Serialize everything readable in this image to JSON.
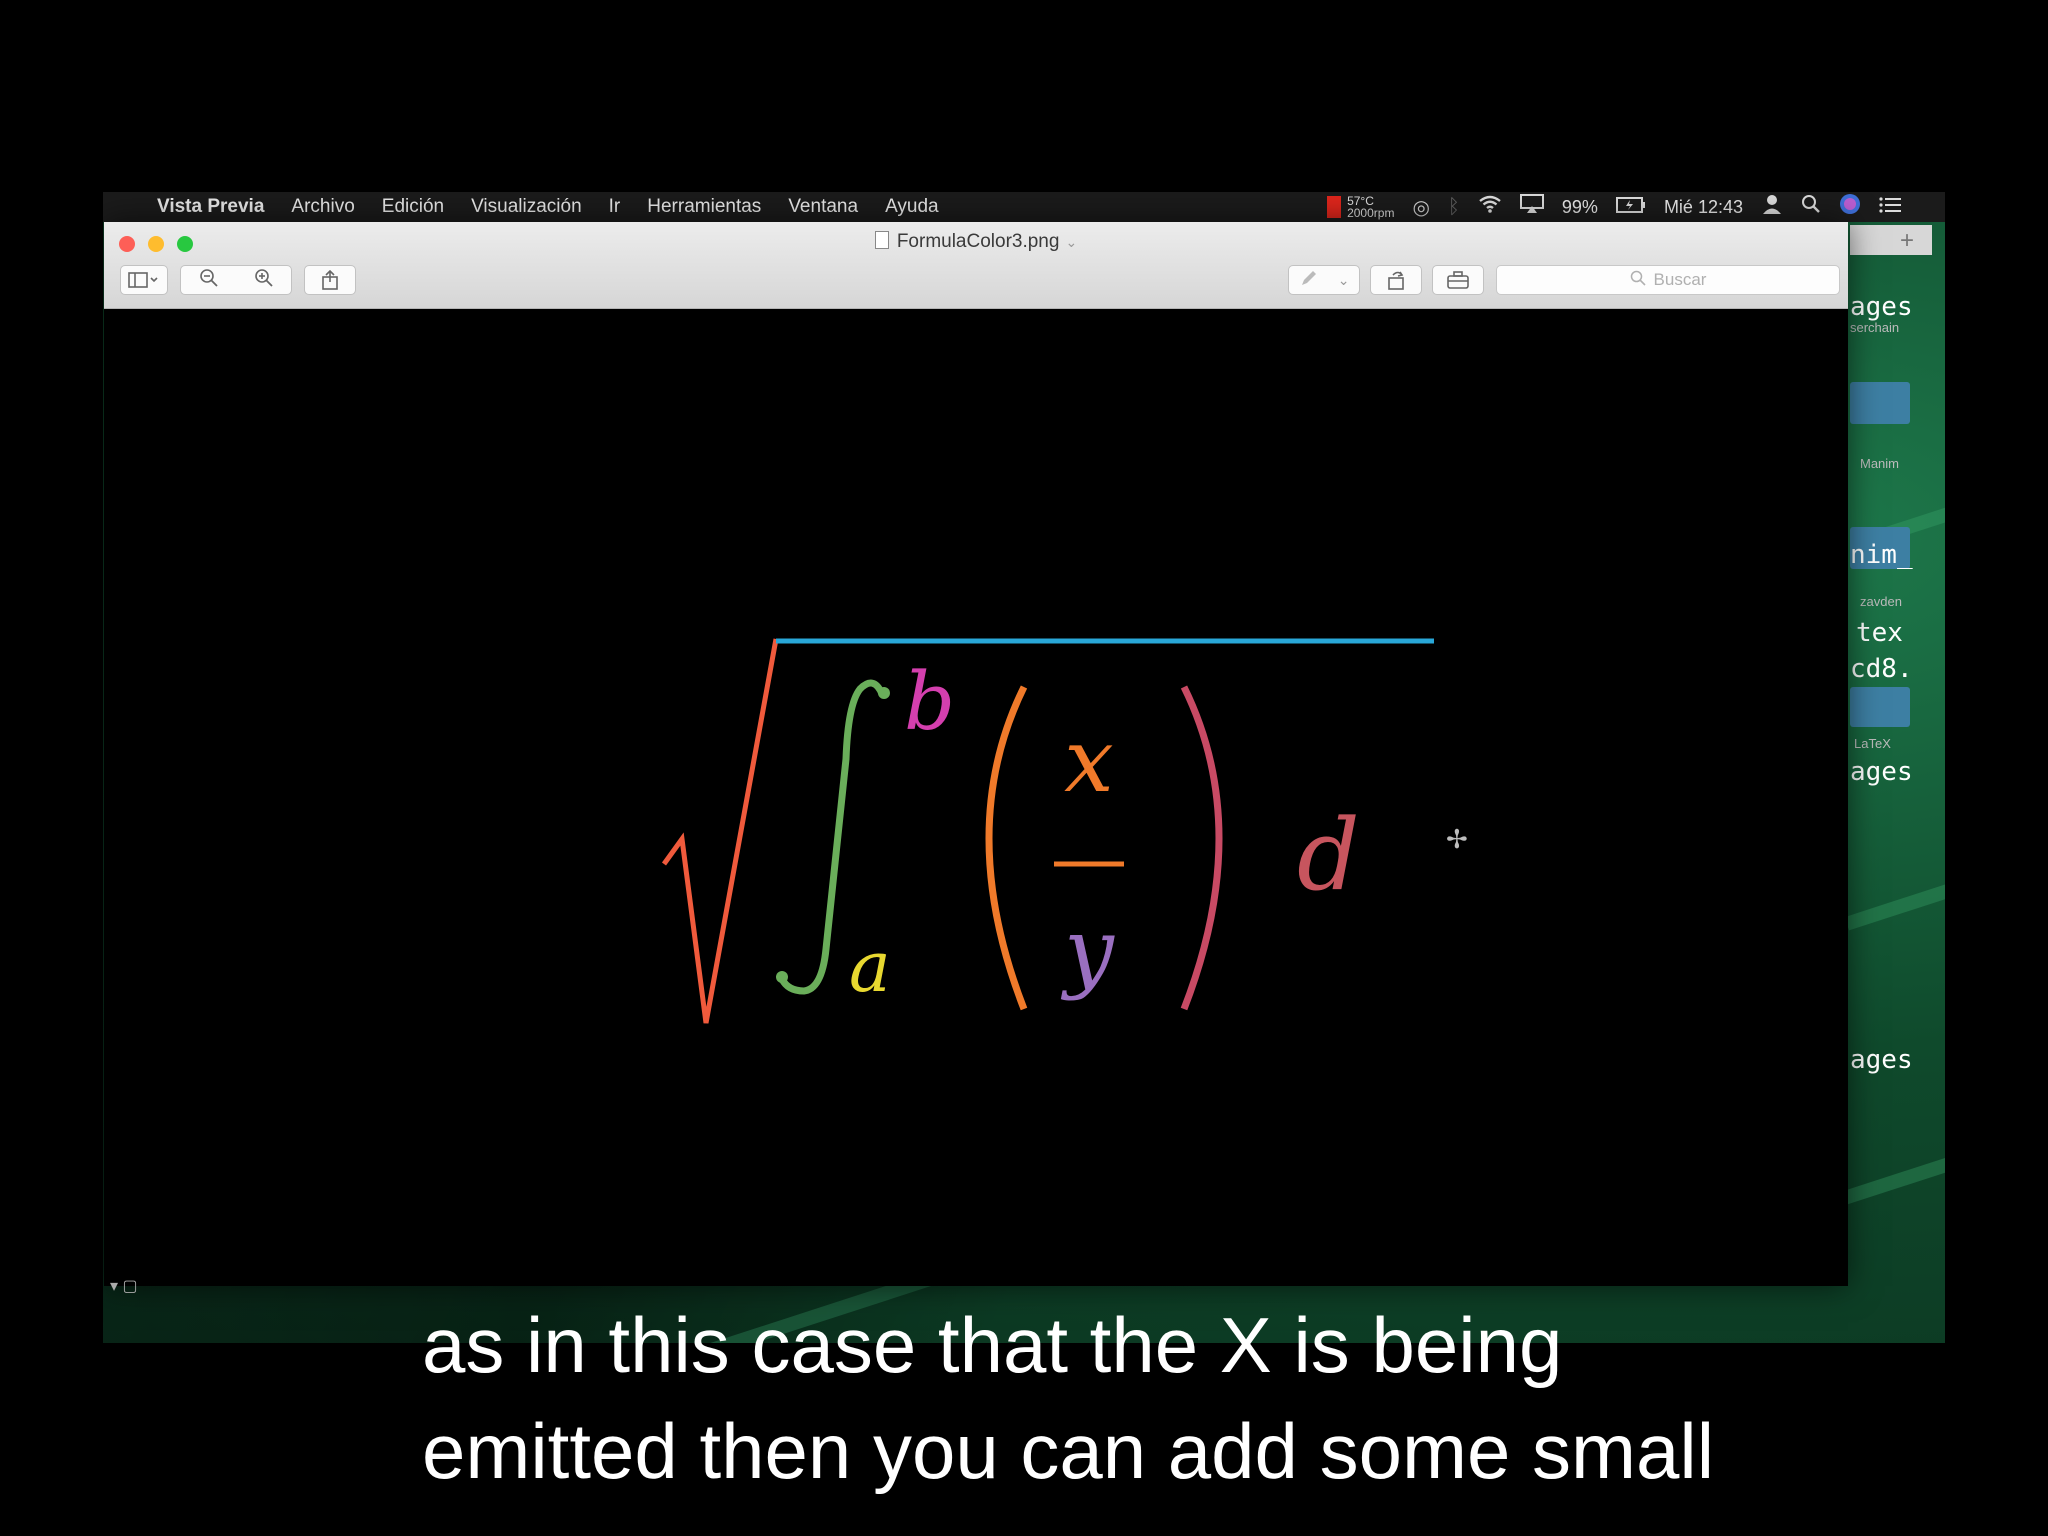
{
  "menubar": {
    "app_name": "Vista Previa",
    "items": [
      "Archivo",
      "Edición",
      "Visualización",
      "Ir",
      "Herramientas",
      "Ventana",
      "Ayuda"
    ],
    "status": {
      "temperature": "57°C",
      "fan": "2000rpm",
      "battery": "99%",
      "clock": "Mié 12:43"
    }
  },
  "window": {
    "title": "FormulaColor3.png",
    "search_placeholder": "Buscar"
  },
  "formula": {
    "upper_limit": "b",
    "lower_limit": "a",
    "numerator": "x",
    "denominator": "y",
    "trailing": "d",
    "colors": {
      "radical": "#f05a3c",
      "vinculum": "#29a7d8",
      "integral": "#6aae5a",
      "upper_limit": "#d43fae",
      "lower_limit": "#e8d830",
      "paren_left": "#f07a2a",
      "fraction_bar": "#f07a2a",
      "numerator": "#f07a2a",
      "denominator": "#9a6fc0",
      "paren_right": "#c84a64",
      "trailing": "#c7555e"
    }
  },
  "sidebar": {
    "items": [
      "ages",
      "serchain",
      "Manim",
      "nim_",
      "zavden",
      "tex",
      "cd8.",
      "LaTeX",
      "ages",
      "ages"
    ]
  },
  "subtitle": {
    "line1": "as in this case that the X is being",
    "line2": "emitted then you can add some small"
  }
}
